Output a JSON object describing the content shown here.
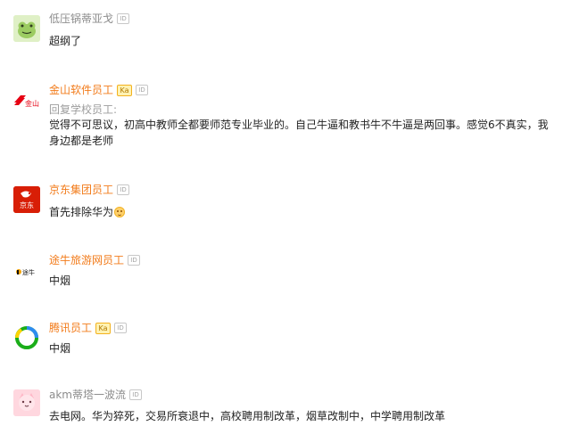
{
  "comments": [
    {
      "author": "低压锅蒂亚戈",
      "badge_id": "ID",
      "text": "超纲了",
      "avatar_icon": "frog-avatar-icon"
    },
    {
      "author": "金山软件员工",
      "badge_ka": "Ka",
      "badge_id": "ID",
      "reply_to": "回复学校员工:",
      "text": "觉得不可思议，初高中教师全都要师范专业毕业的。自己牛逼和教书牛不牛逼是两回事。感觉6不真实，我身边都是老师",
      "avatar_text": "金山",
      "avatar_icon": "kingsoft-logo-icon"
    },
    {
      "author": "京东集团员工",
      "badge_id": "ID",
      "text": "首先排除华为",
      "avatar_text": "京东",
      "avatar_icon": "jd-logo-icon",
      "emoji": "smile-emoji-icon"
    },
    {
      "author": "途牛旅游网员工",
      "badge_id": "ID",
      "text": "中烟",
      "avatar_text": "途牛",
      "avatar_icon": "tuniu-logo-icon"
    },
    {
      "author": "腾讯员工",
      "badge_ka": "Ka",
      "badge_id": "ID",
      "text": "中烟",
      "avatar_icon": "tencent-logo-icon"
    },
    {
      "author": "akm蒂塔一波流",
      "badge_id": "ID",
      "text": "去电网。华为猝死，交易所衰退中，高校聘用制改革，烟草改制中，中学聘用制改革",
      "avatar_icon": "cat-avatar-icon"
    }
  ],
  "colors": {
    "author_orange": "#f27b1a",
    "author_gray": "#8c8c8c",
    "body_text": "#222222",
    "reply_gray": "#9d9d9d",
    "kingsoft_red": "#e60012",
    "jd_red": "#d81e06",
    "tencent_blue": "#2d8cf0",
    "tencent_green": "#1aad19"
  }
}
